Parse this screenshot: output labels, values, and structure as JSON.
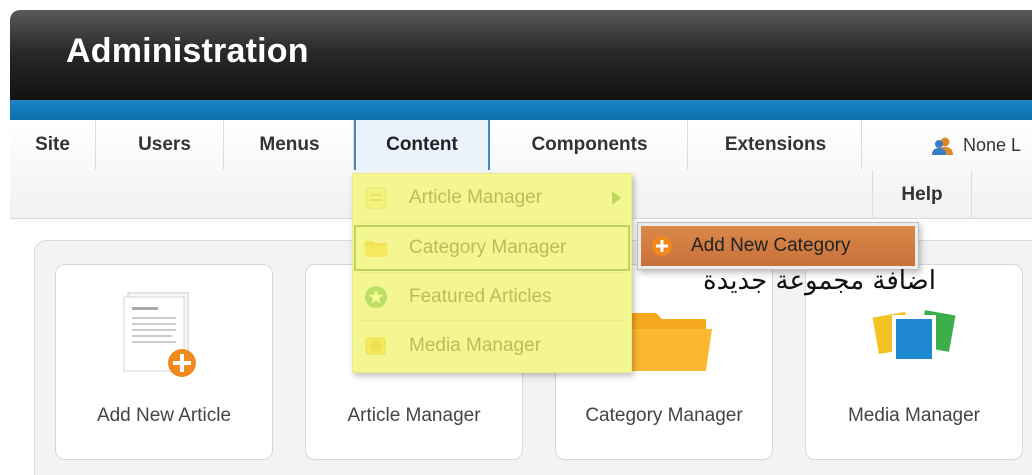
{
  "header": {
    "title": "Administration"
  },
  "menu": {
    "items": [
      {
        "label": "Site"
      },
      {
        "label": "Users"
      },
      {
        "label": "Menus"
      },
      {
        "label": "Content"
      },
      {
        "label": "Components"
      },
      {
        "label": "Extensions"
      }
    ],
    "help": "Help",
    "user_status": "None L"
  },
  "dropdown": {
    "items": [
      {
        "label": "Article Manager",
        "icon": "article-icon"
      },
      {
        "label": "Category Manager",
        "icon": "folder-icon"
      },
      {
        "label": "Featured Articles",
        "icon": "star-icon"
      },
      {
        "label": "Media Manager",
        "icon": "media-icon"
      }
    ]
  },
  "submenu": {
    "label": "Add New Category",
    "icon": "add-icon"
  },
  "annotation": "اضافة مجموعة جديدة",
  "cards": [
    {
      "label": "Add New Article",
      "icon": "article-add-icon"
    },
    {
      "label": "Article Manager",
      "icon": "article-icon"
    },
    {
      "label": "Category Manager",
      "icon": "folder-icon"
    },
    {
      "label": "Media Manager",
      "icon": "media-icon"
    }
  ],
  "colors": {
    "accent_blue": "#0d6ea9",
    "highlight_yellow": "#f5fa6e",
    "submenu_orange": "#c9703a"
  }
}
